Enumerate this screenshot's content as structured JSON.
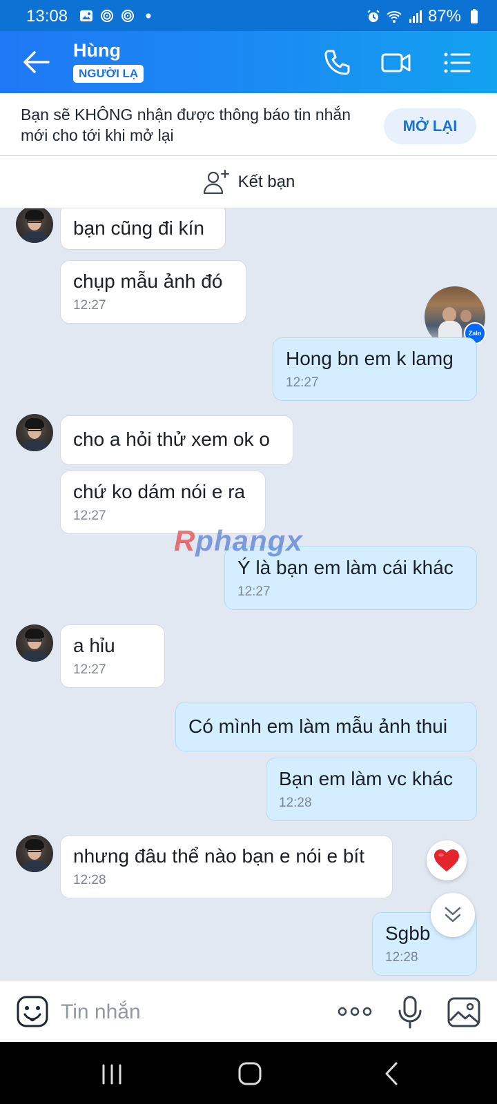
{
  "status_bar": {
    "time": "13:08",
    "battery": "87%"
  },
  "header": {
    "contact_name": "Hùng",
    "badge": "NGƯỜI LẠ"
  },
  "notice": {
    "text": "Bạn sẽ KHÔNG nhận được thông báo tin nhắn mới cho tới khi mở lại",
    "action": "MỞ LẠI"
  },
  "add_friend": {
    "label": "Kết bạn"
  },
  "watermark": {
    "first": "R",
    "rest": "phangx"
  },
  "messages": [
    {
      "side": "in",
      "text": "bạn cũng đi kín",
      "time": ""
    },
    {
      "side": "in",
      "text": "chụp mẫu ảnh đó",
      "time": "12:27"
    },
    {
      "side": "out",
      "text": "Hong bn em k lamg",
      "time": "12:27"
    },
    {
      "side": "in",
      "text": "cho a hỏi thử xem ok o",
      "time": ""
    },
    {
      "side": "in",
      "text": "chứ ko dám nói e ra",
      "time": "12:27"
    },
    {
      "side": "out",
      "text": "Ý là bạn em làm cái khác",
      "time": "12:27"
    },
    {
      "side": "in",
      "text": "a hỉu",
      "time": "12:27"
    },
    {
      "side": "out",
      "text": "Có mình em làm mẫu ảnh thui",
      "time": ""
    },
    {
      "side": "out",
      "text": "Bạn em làm vc khác",
      "time": "12:28"
    },
    {
      "side": "in",
      "text": "nhưng đâu thể nào bạn e nói e bít",
      "time": "12:28"
    },
    {
      "side": "out",
      "text": "Sgbb",
      "time": "12:28"
    }
  ],
  "composer": {
    "placeholder": "Tin nhắn"
  },
  "colors": {
    "header_start": "#1f78f5",
    "header_end": "#12a2f0",
    "chat_background": "#e2e8f1",
    "incoming_bubble": "#ffffff",
    "outgoing_bubble": "#d5eeff",
    "accent": "#1673d8"
  },
  "icons": [
    "back-arrow-icon",
    "phone-icon",
    "video-call-icon",
    "menu-list-icon",
    "add-person-icon",
    "heart-icon",
    "chevron-double-down-icon",
    "emoji-icon",
    "more-dots-icon",
    "microphone-icon",
    "image-icon"
  ]
}
